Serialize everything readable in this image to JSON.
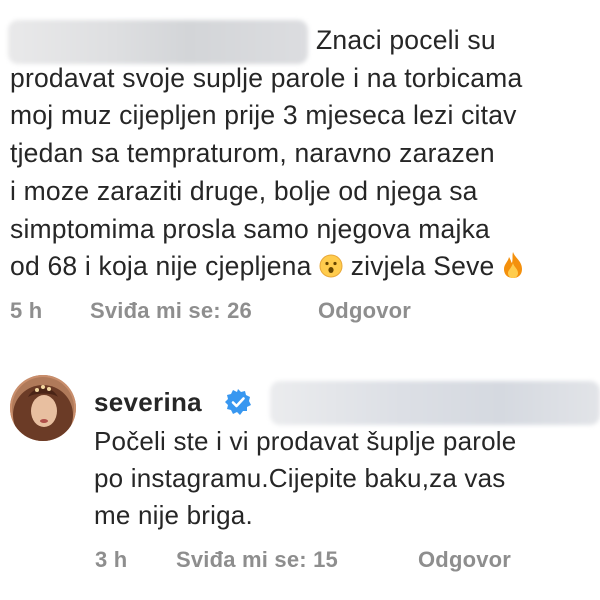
{
  "comment": {
    "lines": [
      "Znaci poceli su",
      "prodavat svoje suplje parole i na torbicama",
      "moj muz cijepljen prije 3 mjeseca lezi citav",
      "tjedan sa tempraturom, naravno zarazen",
      "i moze zaraziti druge, bolje od njega sa",
      "simptomima prosla samo njegova majka",
      "od 68 i koja nije cjepljena",
      "zivjela Seve"
    ],
    "emojis": [
      "surprised-face",
      "fire"
    ],
    "time": "5 h",
    "likes": "Sviđa mi se: 26",
    "reply": "Odgovor"
  },
  "reply_comment": {
    "username": "severina",
    "verified": true,
    "lines": [
      "Počeli ste i vi prodavat šuplje parole",
      "po instagramu.Cijepite baku,za vas",
      "me nije briga."
    ],
    "time": "3 h",
    "likes": "Sviđa mi se: 15",
    "reply": "Odgovor"
  },
  "colors": {
    "text": "#262626",
    "meta": "#8e8e8e",
    "verified_badge": "#3897f0"
  }
}
